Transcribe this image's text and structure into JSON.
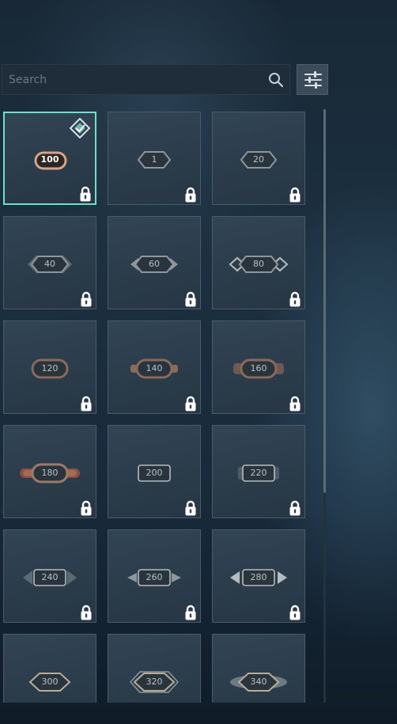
{
  "search": {
    "placeholder": "Search",
    "value": "",
    "icon": "search-icon"
  },
  "filter_button": {
    "icon": "sliders-icon"
  },
  "colors": {
    "selected_border": "#6fe0c8",
    "tile_bg": "#2d3e4d",
    "lock": "#ffffff"
  },
  "tiles": [
    {
      "level": "100",
      "style": "oval-copper",
      "locked": true,
      "selected": true,
      "equipped": true
    },
    {
      "level": "1",
      "style": "hex-small",
      "locked": true
    },
    {
      "level": "20",
      "style": "hex-large",
      "locked": true
    },
    {
      "level": "40",
      "style": "hex-arrows1",
      "locked": true
    },
    {
      "level": "60",
      "style": "hex-arrows2",
      "locked": true
    },
    {
      "level": "80",
      "style": "hex-arrows3",
      "locked": true
    },
    {
      "level": "120",
      "style": "oval-1",
      "locked": true
    },
    {
      "level": "140",
      "style": "oval-2",
      "locked": true
    },
    {
      "level": "160",
      "style": "oval-3",
      "locked": true
    },
    {
      "level": "180",
      "style": "oval-4",
      "locked": true
    },
    {
      "level": "200",
      "style": "rect-1",
      "locked": true
    },
    {
      "level": "220",
      "style": "rect-2",
      "locked": true
    },
    {
      "level": "240",
      "style": "rect-arrow1",
      "locked": true
    },
    {
      "level": "260",
      "style": "rect-arrow2",
      "locked": true
    },
    {
      "level": "280",
      "style": "rect-arrow3",
      "locked": true
    },
    {
      "level": "300",
      "style": "diamond-1",
      "locked": false
    },
    {
      "level": "320",
      "style": "diamond-2",
      "locked": false
    },
    {
      "level": "340",
      "style": "diamond-3",
      "locked": false
    }
  ]
}
